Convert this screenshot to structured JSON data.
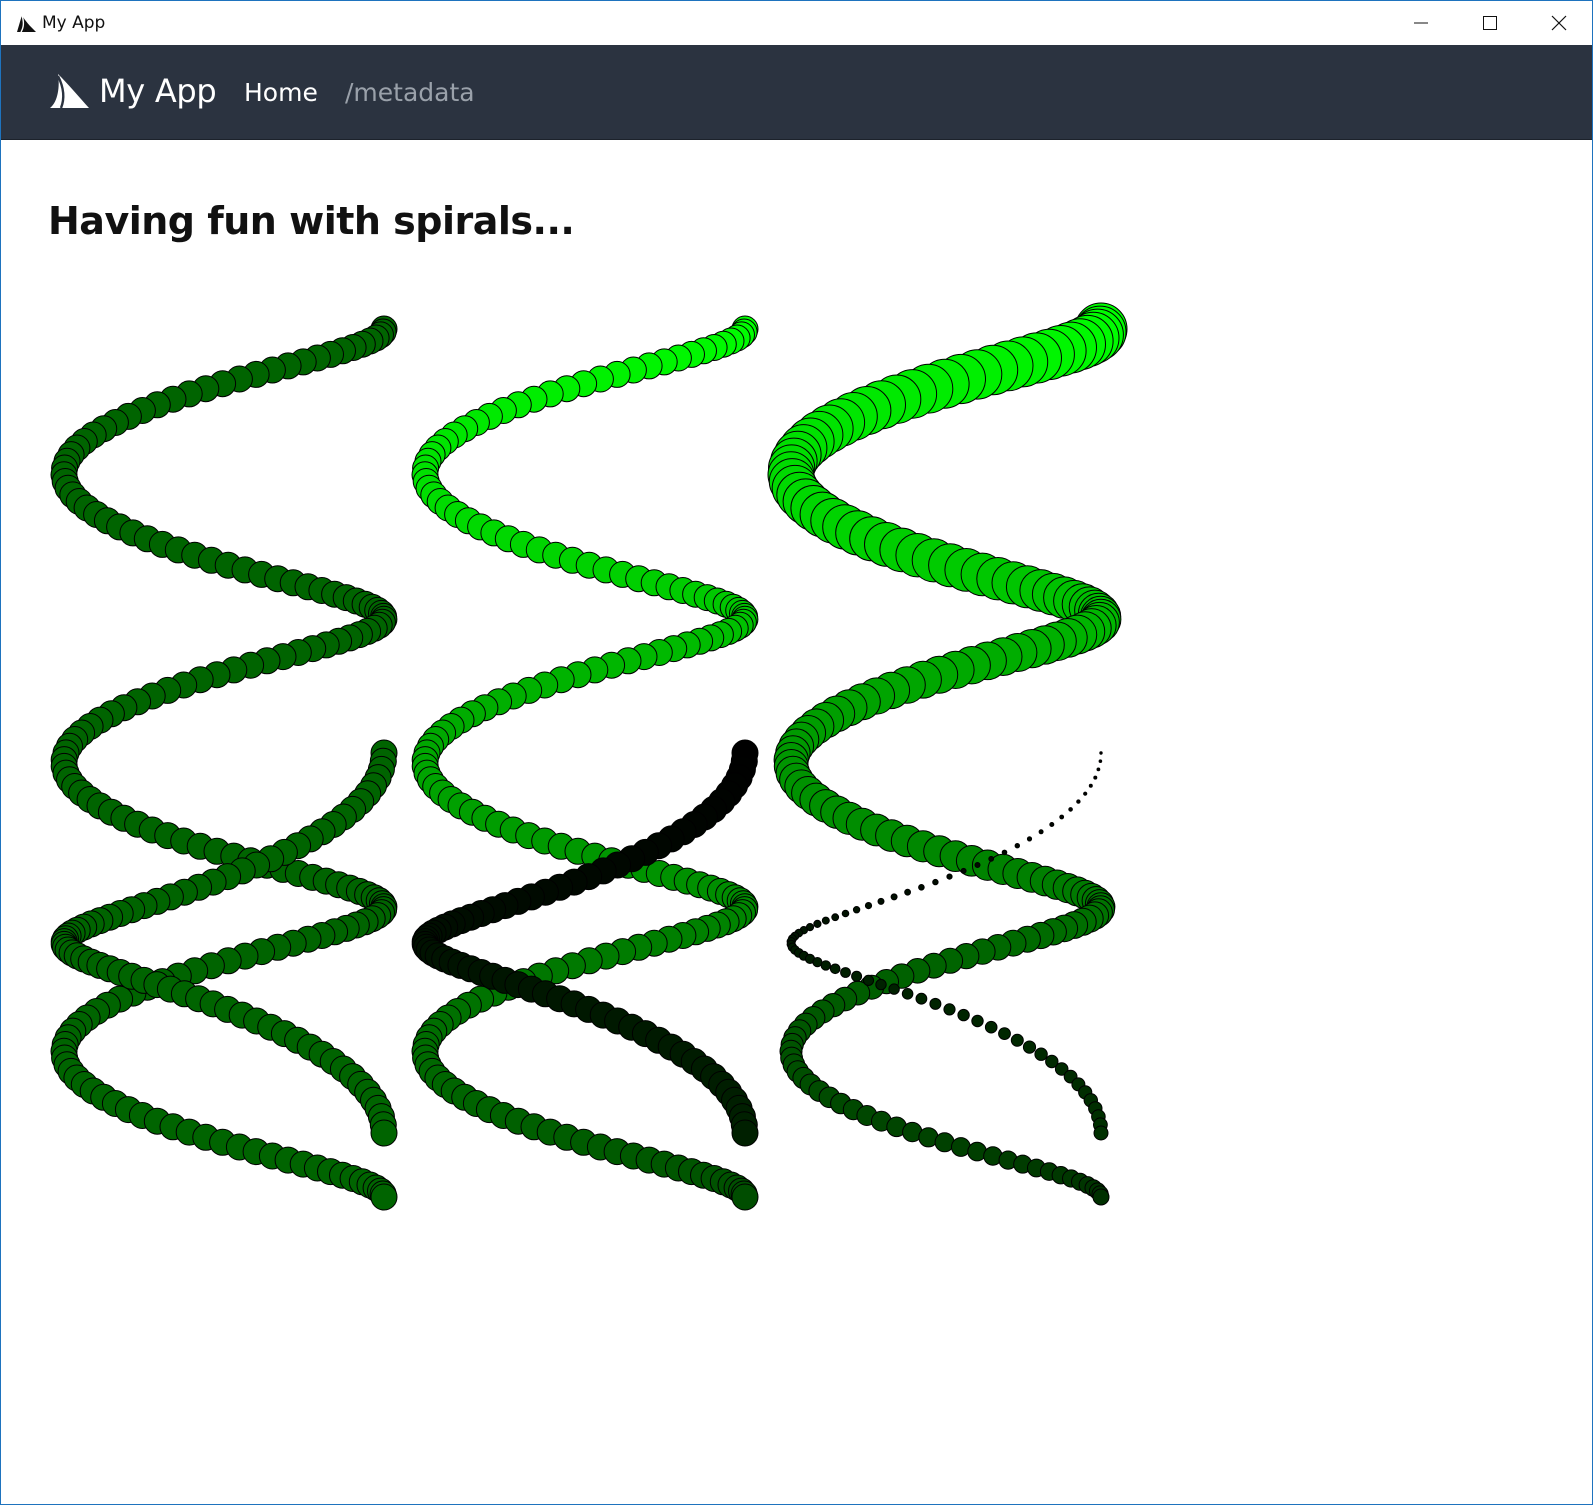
{
  "window": {
    "title": "My App",
    "controls": {
      "minimize": "minimize-icon",
      "maximize": "maximize-icon",
      "close": "close-icon"
    }
  },
  "navbar": {
    "brand": "My App",
    "links": [
      {
        "label": "Home"
      },
      {
        "label": "/metadata"
      }
    ],
    "logo_icon": "shark-fin-icon"
  },
  "main": {
    "heading": "Having fun with spirals..."
  },
  "colors": {
    "navbar_bg": "#2b3340",
    "spiral_1_fill": "#006400",
    "spiral_2_top": "#00ff00",
    "spiral_2_bottom": "#002000",
    "spiral_3_top": "#00ff00",
    "spiral_3_bottom": "#003000",
    "stroke": "#000000"
  },
  "spirals": [
    {
      "name": "uniform",
      "point_count": 180,
      "size": "constant",
      "color": "constant dark green"
    },
    {
      "name": "color-gradient",
      "point_count": 180,
      "size": "constant",
      "color": "bright green to black"
    },
    {
      "name": "size-gradient",
      "point_count": 180,
      "size": "large to small",
      "color": "bright green to dark green"
    }
  ]
}
